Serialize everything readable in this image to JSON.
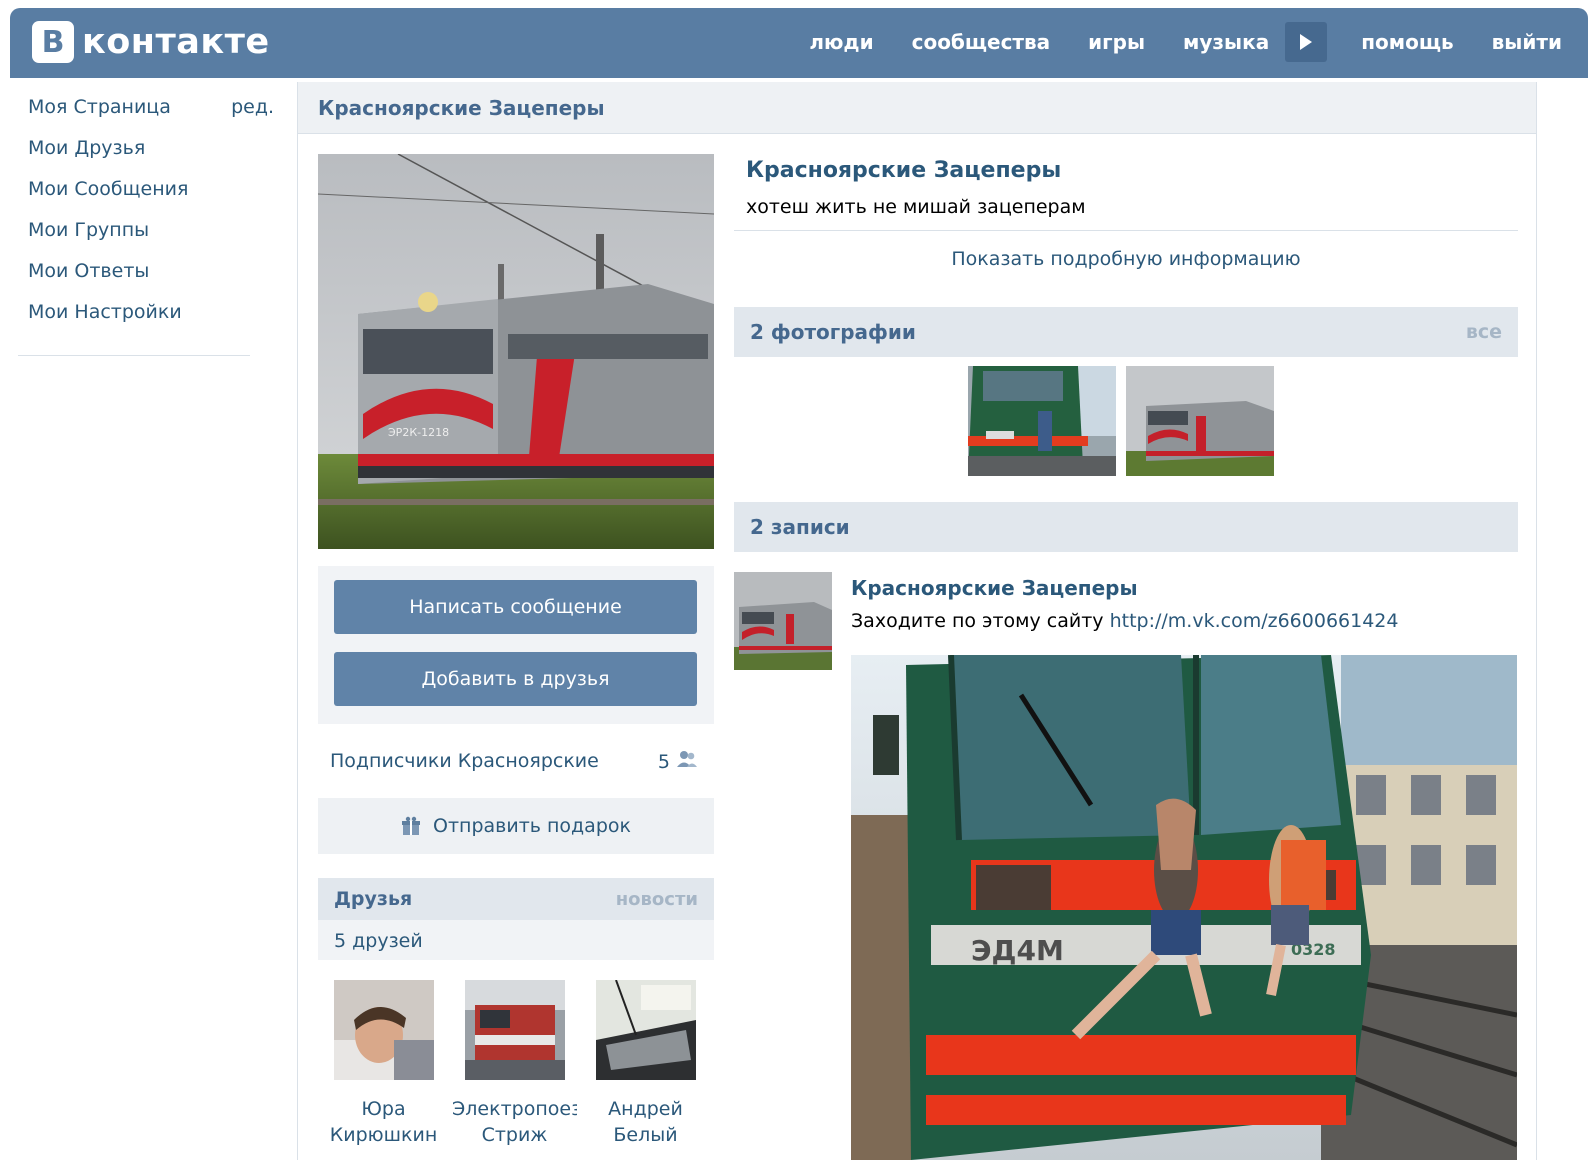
{
  "header": {
    "logo_letter": "B",
    "logo_text": "контакте",
    "nav": [
      "люди",
      "сообщества",
      "игры",
      "музыка",
      "помощь",
      "выйти"
    ]
  },
  "leftmenu": {
    "items": [
      "Моя Страница",
      "Мои Друзья",
      "Мои Сообщения",
      "Мои Группы",
      "Мои Ответы",
      "Мои Настройки"
    ],
    "edit": "ред."
  },
  "page": {
    "title": "Красноярские Зацеперы"
  },
  "profile": {
    "name": "Красноярские Зацеперы",
    "status": "хотеш жить не мишай зацеперам",
    "show_more": "Показать подробную информацию",
    "avatar_label": "ЭР2К-1218"
  },
  "actions": {
    "message": "Написать сообщение",
    "add_friend": "Добавить в друзья"
  },
  "subscribers": {
    "label": "Подписчики Красноярские",
    "count": "5"
  },
  "gift": {
    "label": "Отправить подарок"
  },
  "friends": {
    "title": "Друзья",
    "news": "новости",
    "count": "5 друзей",
    "items": [
      {
        "first": "Юра",
        "last": "Кирюшкин"
      },
      {
        "first": "Электропоезд",
        "last": "Стриж"
      },
      {
        "first": "Андрей",
        "last": "Белый"
      }
    ]
  },
  "photos": {
    "title": "2 фотографии",
    "all": "все"
  },
  "posts": {
    "title": "2 записи",
    "author": "Красноярские Зацеперы",
    "text": "Заходите по этому сайту ",
    "link": "http://m.vk.com/z6600661424",
    "train_number": "ЭД4М",
    "train_side": "0328"
  },
  "colors": {
    "header_bg": "#597da3",
    "link": "#2b587a",
    "button": "#6083a8",
    "section_bg": "#e1e7ed"
  }
}
